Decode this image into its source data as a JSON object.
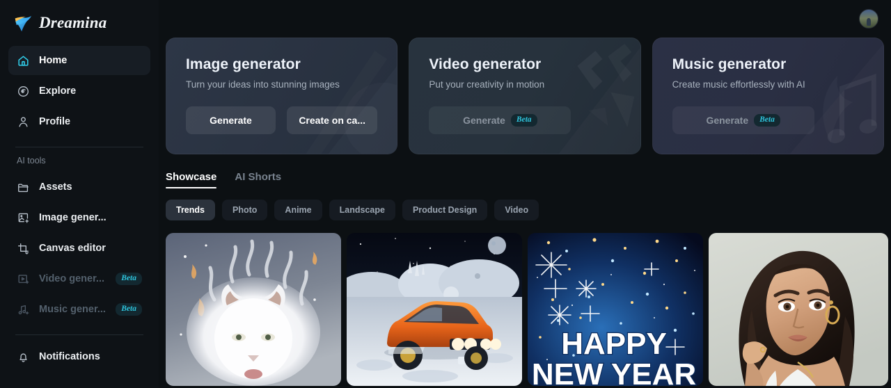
{
  "brand": {
    "name": "Dreamina",
    "logo_icon": "dreamina-arrow-logo"
  },
  "sidebar": {
    "primary": [
      {
        "label": "Home",
        "icon": "home-icon",
        "active": true
      },
      {
        "label": "Explore",
        "icon": "compass-icon",
        "active": false
      },
      {
        "label": "Profile",
        "icon": "user-icon",
        "active": false
      }
    ],
    "group_title": "AI tools",
    "tools": [
      {
        "label": "Assets",
        "icon": "folder-icon",
        "disabled": false,
        "badge": ""
      },
      {
        "label": "Image gener...",
        "icon": "image-add-icon",
        "disabled": false,
        "badge": ""
      },
      {
        "label": "Canvas editor",
        "icon": "canvas-crop-icon",
        "disabled": false,
        "badge": ""
      },
      {
        "label": "Video gener...",
        "icon": "video-add-icon",
        "disabled": true,
        "badge": "Beta"
      },
      {
        "label": "Music gener...",
        "icon": "music-note-add-icon",
        "disabled": true,
        "badge": "Beta"
      }
    ],
    "footer": [
      {
        "label": "Notifications",
        "icon": "bell-icon",
        "disabled": false,
        "badge": ""
      }
    ]
  },
  "topbar": {
    "avatar_name": "user-avatar"
  },
  "hero_cards": [
    {
      "title": "Image generator",
      "subtitle": "Turn your ideas into stunning images",
      "buttons": [
        {
          "label": "Generate",
          "disabled": false,
          "badge": ""
        },
        {
          "label": "Create on ca...",
          "disabled": false,
          "badge": ""
        }
      ]
    },
    {
      "title": "Video generator",
      "subtitle": "Put your creativity in motion",
      "buttons": [
        {
          "label": "Generate",
          "disabled": true,
          "badge": "Beta"
        }
      ]
    },
    {
      "title": "Music generator",
      "subtitle": "Create music effortlessly with AI",
      "buttons": [
        {
          "label": "Generate",
          "disabled": true,
          "badge": "Beta"
        }
      ]
    }
  ],
  "tabs": [
    {
      "label": "Showcase",
      "active": true
    },
    {
      "label": "AI Shorts",
      "active": false
    }
  ],
  "chips": [
    {
      "label": "Trends",
      "active": true
    },
    {
      "label": "Photo",
      "active": false
    },
    {
      "label": "Anime",
      "active": false
    },
    {
      "label": "Landscape",
      "active": false
    },
    {
      "label": "Product Design",
      "active": false
    },
    {
      "label": "Video",
      "active": false
    }
  ],
  "gallery": [
    {
      "name": "white-lion-flame-mane",
      "alt": "White lion with flowing flame-like mane"
    },
    {
      "name": "orange-car-on-moon",
      "alt": "Orange classic coupe on lunar landscape with domes"
    },
    {
      "name": "happy-new-year-starfield",
      "alt": "Happy New Year text over blue starfield",
      "text_line1": "HAPPY",
      "text_line2": "NEW YEAR"
    },
    {
      "name": "portrait-woman",
      "alt": "Portrait of a woman with wavy dark hair"
    }
  ],
  "colors": {
    "accent_cyan": "#2ec5dd",
    "sidebar_bg": "#0e1216",
    "main_bg": "#0c1013",
    "active_item_bg": "#171d24",
    "chip_bg": "#161b22",
    "chip_active_bg": "#2b323c"
  }
}
